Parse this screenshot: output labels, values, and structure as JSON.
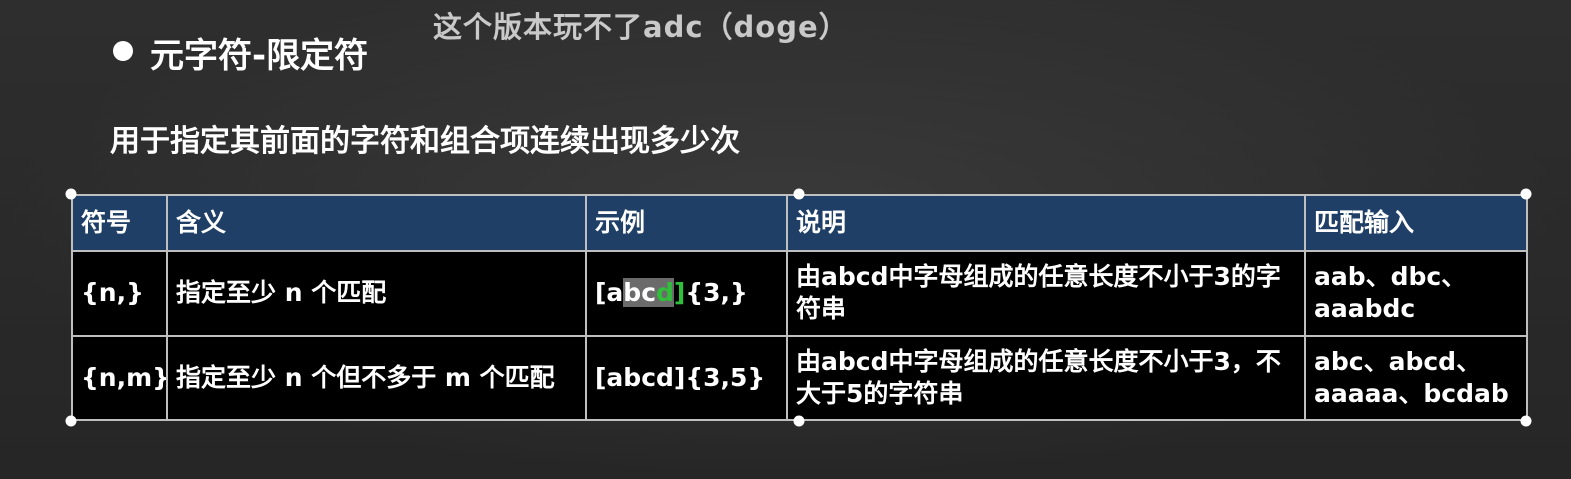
{
  "caption": {
    "text": "这个版本玩不了adc（doge）"
  },
  "slide": {
    "title": "元字符-限定符",
    "description": "用于指定其前面的字符和组合项连续出现多少次"
  },
  "table": {
    "headers": [
      "符号",
      "含义",
      "示例",
      "说明",
      "匹配输入"
    ],
    "rows": [
      {
        "symbol": "{n,}",
        "meaning": "指定至少 n 个匹配",
        "example_parts": [
          "[a",
          "bc",
          "d",
          "]",
          "{3,}"
        ],
        "explanation": "由abcd中字母组成的任意长度不小于3的字符串",
        "matches": "aab、dbc、aaabdc"
      },
      {
        "symbol": "{n,m}",
        "meaning": "指定至少 n 个但不多于 m 个匹配",
        "example": "[abcd]{3,5}",
        "explanation": "由abcd中字母组成的任意长度不小于3，不大于5的字符串",
        "matches": "abc、abcd、aaaaa、bcdab"
      }
    ]
  },
  "colors": {
    "header_bg": "#1f3f66",
    "cell_bg": "#000000",
    "highlight_green": "#2fbf3a",
    "highlight_gray": "#6b6b6b"
  },
  "icons": {
    "bullet": "bullet-dot-icon",
    "selection_handles": "selection-handle-icon"
  }
}
